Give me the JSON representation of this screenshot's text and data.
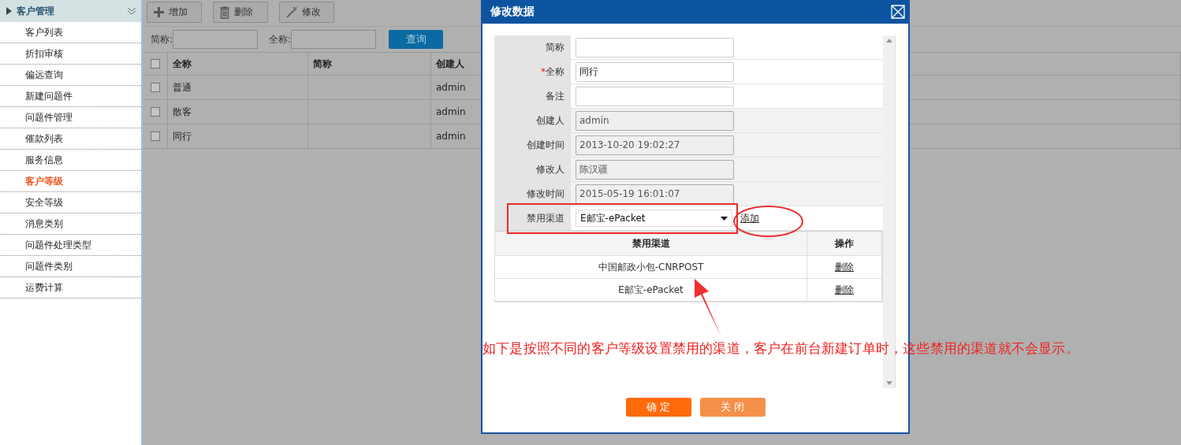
{
  "sidebar": {
    "title": "客户管理",
    "items": [
      {
        "label": "客户列表",
        "selected": false
      },
      {
        "label": "折扣审核",
        "selected": false
      },
      {
        "label": "偏远查询",
        "selected": false
      },
      {
        "label": "新建问题件",
        "selected": false
      },
      {
        "label": "问题件管理",
        "selected": false
      },
      {
        "label": "催款列表",
        "selected": false
      },
      {
        "label": "服务信息",
        "selected": false
      },
      {
        "label": "客户等级",
        "selected": true
      },
      {
        "label": "安全等级",
        "selected": false
      },
      {
        "label": "消息类别",
        "selected": false
      },
      {
        "label": "问题件处理类型",
        "selected": false
      },
      {
        "label": "问题件类别",
        "selected": false
      },
      {
        "label": "运费计算",
        "selected": false
      }
    ]
  },
  "toolbar": {
    "buttons": [
      {
        "kind": "add",
        "label": "增加"
      },
      {
        "kind": "delete",
        "label": "删除"
      },
      {
        "kind": "edit",
        "label": "修改"
      }
    ]
  },
  "search": {
    "fields": [
      {
        "label": "简称:"
      },
      {
        "label": "全称:"
      }
    ],
    "button": "查询"
  },
  "table": {
    "header_checked": false,
    "columns": [
      "全称",
      "简称",
      "创建人"
    ],
    "rows": [
      {
        "checked": false,
        "full_name": "普通",
        "creator": "admin"
      },
      {
        "checked": false,
        "full_name": "散客",
        "creator": "admin"
      },
      {
        "checked": false,
        "full_name": "同行",
        "creator": "admin"
      }
    ]
  },
  "dialog": {
    "title": "修改数据",
    "fields": [
      {
        "label": "简称",
        "kind": "input"
      },
      {
        "label": "全称",
        "kind": "input",
        "required_mark": "*",
        "value": "同行"
      },
      {
        "label": "备注",
        "kind": "input"
      },
      {
        "label": "创建人",
        "kind": "readonly",
        "value": "admin"
      },
      {
        "label": "创建时间",
        "kind": "readonly",
        "value": "2013-10-20 19:02:27"
      },
      {
        "label": "修改人",
        "kind": "readonly",
        "value": "陈汉疆"
      },
      {
        "label": "修改时间",
        "kind": "readonly",
        "value": "2015-05-19 16:01:07"
      },
      {
        "label": "禁用渠道",
        "kind": "select",
        "value": "E邮宝-ePacket",
        "action": "添加"
      }
    ],
    "channels": {
      "columns": [
        "禁用渠道",
        "操作"
      ],
      "rows": [
        {
          "name": "中国邮政小包-CNRPOST",
          "action": "删除"
        },
        {
          "name": "E邮宝-ePacket",
          "action": "删除"
        }
      ]
    },
    "buttons": [
      {
        "kind": "primary",
        "label": "确 定"
      },
      {
        "kind": "secondary",
        "label": "关 闭"
      }
    ]
  },
  "annotation": {
    "text": "如下是按照不同的客户等级设置禁用的渠道，客户在前台新建订单时，这些禁用的渠道就不会显示。"
  }
}
